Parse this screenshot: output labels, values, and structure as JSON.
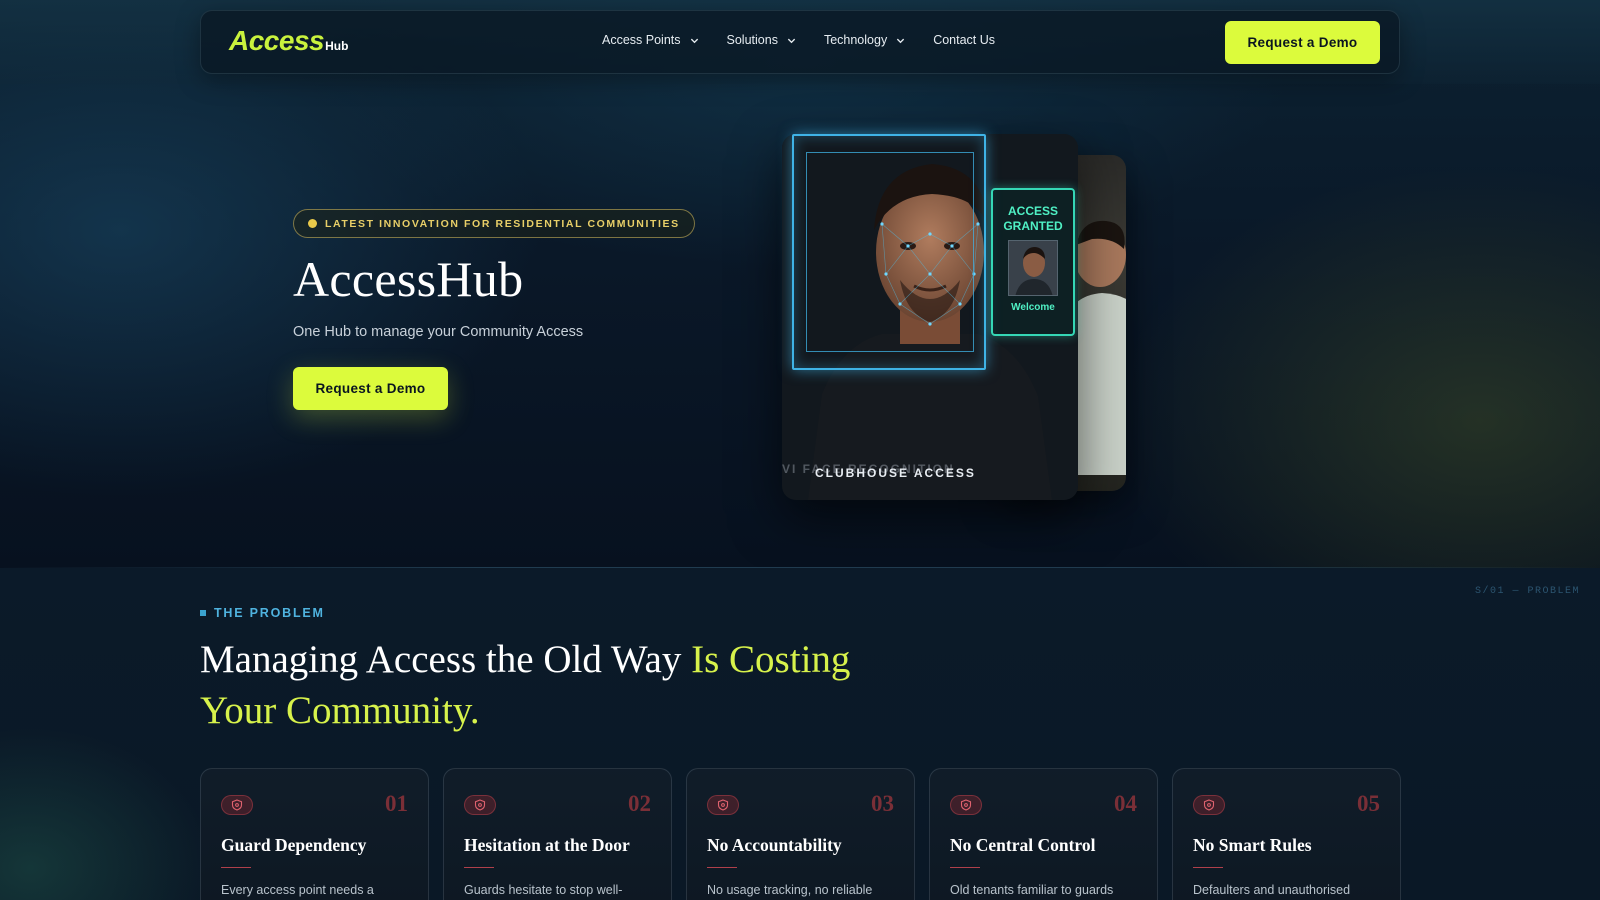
{
  "nav": {
    "logo_main": "Access",
    "logo_sub": "Hub",
    "menu": [
      {
        "label": "Access Points",
        "has_dropdown": true
      },
      {
        "label": "Solutions",
        "has_dropdown": true
      },
      {
        "label": "Technology",
        "has_dropdown": true
      },
      {
        "label": "Contact Us",
        "has_dropdown": false
      }
    ],
    "cta_label": "Request a Demo"
  },
  "hero": {
    "badge": "LATEST INNOVATION FOR RESIDENTIAL COMMUNITIES",
    "title": "AccessHub",
    "subtitle": "One Hub to manage your Community Access",
    "cta_label": "Request a Demo",
    "visual": {
      "access_granted": "ACCESS GRANTED",
      "welcome": "Welcome",
      "caption": "CLUBHOUSE ACCESS",
      "caption_ghost": "VI FACE RECOGNITION"
    }
  },
  "problem": {
    "section_tag": "S/01 — PROBLEM",
    "eyebrow": "THE PROBLEM",
    "title_plain": "Managing Access the Old Way ",
    "title_accent": "Is Costing Your Community.",
    "cards": [
      {
        "num": "01",
        "title": "Guard Dependency",
        "desc": "Every access point needs a"
      },
      {
        "num": "02",
        "title": "Hesitation at the Door",
        "desc": "Guards hesitate to stop well-"
      },
      {
        "num": "03",
        "title": "No Accountability",
        "desc": "No usage tracking, no reliable"
      },
      {
        "num": "04",
        "title": "No Central Control",
        "desc": "Old tenants familiar to guards"
      },
      {
        "num": "05",
        "title": "No Smart Rules",
        "desc": "Defaulters and unauthorised"
      }
    ]
  },
  "colors": {
    "accent_lime": "#dcfb3c",
    "background": "#081421",
    "scan_blue": "#3fb3e6",
    "granted_green": "#4ff0c4",
    "problem_red": "#7a2f37"
  },
  "icons": {
    "dropdown": "chevron-down-icon",
    "card": "shield-icon",
    "badge": "dot-icon"
  }
}
